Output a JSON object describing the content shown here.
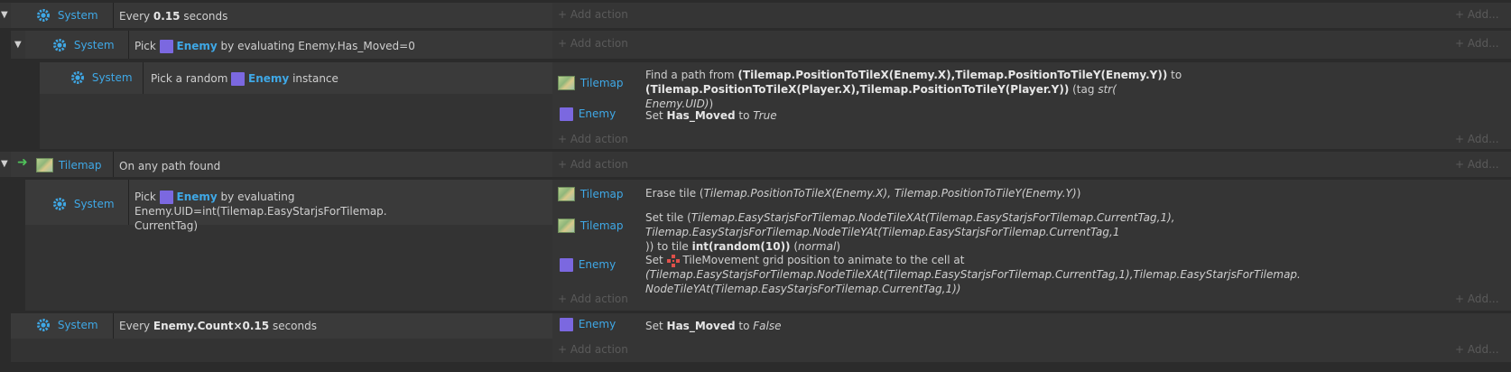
{
  "ui": {
    "add_action": "+ Add action",
    "add_more": "+ Add..."
  },
  "objects": {
    "system": "System",
    "enemy": "Enemy",
    "tilemap": "Tilemap"
  },
  "events": {
    "e1": {
      "cond_prefix": "Every ",
      "cond_bold": "0.15",
      "cond_suffix": " seconds"
    },
    "e2": {
      "cond_prefix": "Pick ",
      "cond_suffix": " by evaluating Enemy.Has_Moved=0"
    },
    "e3": {
      "cond_prefix": "Pick a random ",
      "cond_suffix": " instance",
      "action1": {
        "p1": "Find a path from ",
        "b1": "(Tilemap.PositionToTileX(Enemy.X),Tilemap.PositionToTileY(Enemy.Y))",
        "p2": " to ",
        "b2": "(Tilemap.PositionToTileX(Player.X),Tilemap.PositionToTileY(Player.Y))",
        "p3": " (tag ",
        "i1": "str(",
        "i2": "Enemy.UID)",
        "p4": ")"
      },
      "action2": {
        "p1": "Set ",
        "b1": "Has_Moved",
        "p2": " to ",
        "i1": "True"
      }
    },
    "e4": {
      "cond": "On any path found"
    },
    "e5": {
      "cond_prefix": "Pick ",
      "cond_suffix": " by evaluating Enemy.UID=int(Tilemap.EasyStarjsForTilemap.",
      "cond_line2": "CurrentTag)",
      "action1": {
        "p1": "Erase tile (",
        "i1": "Tilemap.PositionToTileX(Enemy.X), Tilemap.PositionToTileY(Enemy.Y)",
        "p2": ")"
      },
      "action2": {
        "p1": "Set tile (",
        "i1": "Tilemap.EasyStarjsForTilemap.NodeTileXAt(Tilemap.EasyStarjsForTilemap.CurrentTag,1), Tilemap.EasyStarjsForTilemap.NodeTileYAt(Tilemap.EasyStarjsForTilemap.CurrentTag,1",
        "p2": ")) to tile ",
        "b1": "int(random(10))",
        "p3": " (",
        "i2": "normal",
        "p4": ")"
      },
      "action3": {
        "p1": "Set ",
        "behavior": "TileMovement",
        "p2": " grid position to animate to the cell at ",
        "i1": "(Tilemap.EasyStarjsForTilemap.NodeTileXAt(Tilemap.EasyStarjsForTilemap.CurrentTag,1),Tilemap.EasyStarjsForTilemap.",
        "i2": "NodeTileYAt(Tilemap.EasyStarjsForTilemap.CurrentTag,1))"
      }
    },
    "e6": {
      "cond_prefix": "Every ",
      "cond_bold": "Enemy.Count×0.15",
      "cond_suffix": " seconds",
      "action1": {
        "p1": "Set ",
        "b1": "Has_Moved",
        "p2": " to ",
        "i1": "False"
      }
    }
  },
  "colors": {
    "object_name": "#3fa8e6",
    "enemy_square": "#7b68e0",
    "trigger_arrow": "#4fc35a"
  }
}
